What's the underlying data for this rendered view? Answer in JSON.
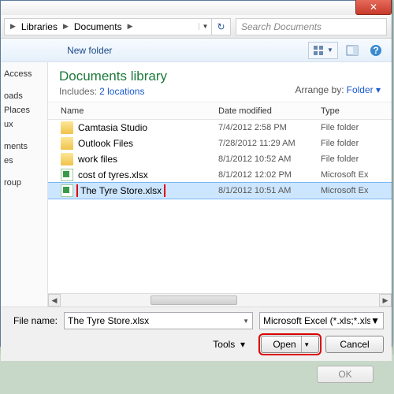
{
  "breadcrumb": {
    "seg1": "Libraries",
    "seg2": "Documents"
  },
  "search": {
    "placeholder": "Search Documents"
  },
  "toolbar": {
    "newfolder": "New folder"
  },
  "sidebar": {
    "items": [
      "Access",
      "",
      "oads",
      "Places",
      "ux",
      "",
      "ments",
      "es",
      "",
      "roup"
    ]
  },
  "library": {
    "title": "Documents library",
    "includes_label": "Includes:",
    "includes_link": "2 locations",
    "arrange_label": "Arrange by:",
    "arrange_value": "Folder"
  },
  "columns": {
    "name": "Name",
    "date": "Date modified",
    "type": "Type"
  },
  "files": [
    {
      "icon": "folder",
      "name": "Camtasia Studio",
      "date": "7/4/2012 2:58 PM",
      "type": "File folder"
    },
    {
      "icon": "folder",
      "name": "Outlook Files",
      "date": "7/28/2012 11:29 AM",
      "type": "File folder"
    },
    {
      "icon": "folder",
      "name": "work files",
      "date": "8/1/2012 10:52 AM",
      "type": "File folder"
    },
    {
      "icon": "xls",
      "name": "cost of tyres.xlsx",
      "date": "8/1/2012 12:02 PM",
      "type": "Microsoft Ex"
    },
    {
      "icon": "xls",
      "name": "The Tyre Store.xlsx",
      "date": "8/1/2012 10:51 AM",
      "type": "Microsoft Ex",
      "selected": true,
      "highlight": true
    }
  ],
  "filename": {
    "label": "File name:",
    "value": "The Tyre Store.xlsx"
  },
  "filter": {
    "value": "Microsoft Excel (*.xls;*.xlsb;*.xls"
  },
  "buttons": {
    "tools": "Tools",
    "open": "Open",
    "cancel": "Cancel"
  },
  "background": {
    "ok": "OK"
  }
}
